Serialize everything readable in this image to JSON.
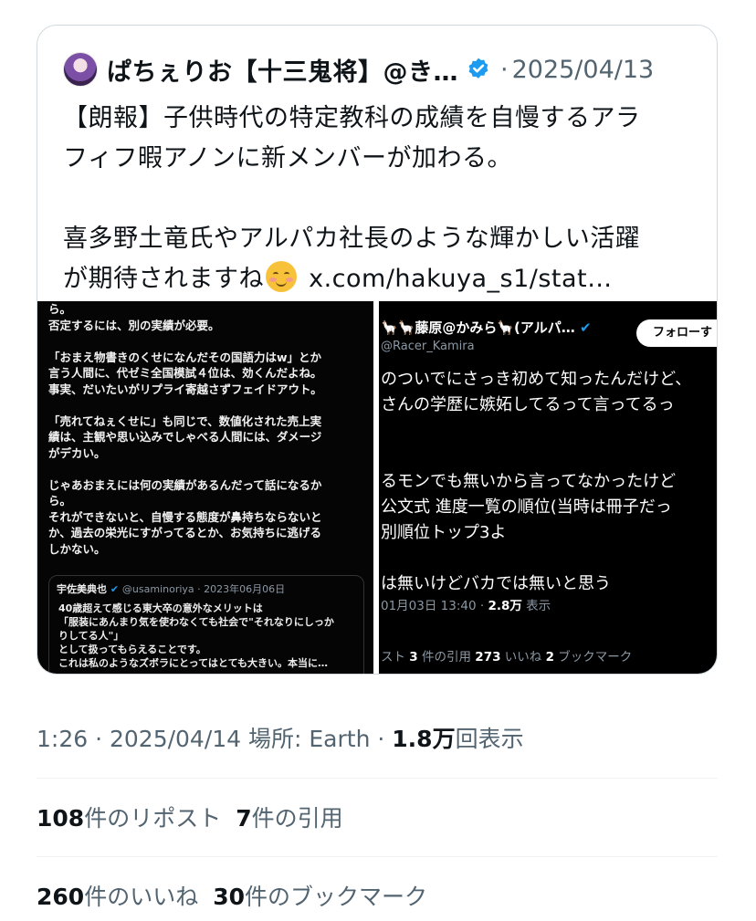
{
  "quoted": {
    "author_name": "ぱちぇりお【十三鬼将】@き…",
    "separator": "·",
    "date": "2025/04/13",
    "text_line1": "【朗報】子供時代の特定教科の成績を自慢するアラ\nフィフ暇アノンに新メンバーが加わる。\n\n喜多野土竜氏やアルパカ社長のような輝かしい活躍\nが期待されますね",
    "link": "x.com/hakuya_s1/stat…",
    "image_left": {
      "body": "ら。\n否定するには、別の実績が必要。\n\n「おまえ物書きのくせになんだその国語力はw」とか\n言う人間に、代ゼミ全国模試４位は、効くんだよね。\n事実、だいたいがリプライ寄越さずフェイドアウト。\n\n「売れてねぇくせに」も同じで、数値化された売上実\n績は、主観や思い込みでしゃべる人間には、ダメージ\nがデカい。\n\nじゃあおまえには何の実績があるんだって話になるか\nら。\nそれができないと、自慢する態度が鼻持ちならないと\nか、過去の栄光にすがってるとか、お気持ちに逃げる\nしかない。",
      "inner_author": "宇佐美典也",
      "inner_handle": "@usaminoriya · 2023年06月06日",
      "inner_body": "40歳超えて感じる東大卒の意外なメリットは\n「服装にあんまり気を使わなくても社会で\"それなりにしっか\nりしてる人\"」\nとして扱ってもらえることです。\nこれは私のようなズボラにとってはとても大きい。本当に…"
    },
    "image_right": {
      "name": "🦙🦙藤原@かみら🦙(アルパ…",
      "handle": "@Racer_Kamira",
      "follow_label": "フォローす",
      "body": "のついでにさっき初めて知ったんだけど、\nさんの学歴に嫉妬してるって言ってるっ\n\n\nるモンでも無いから言ってなかったけど\n公文式 進度一覧の順位(当時は冊子だっ\n別順位トップ3よ\n\nは無いけどバカでは無いと思う",
      "timestamp": "01月03日 13:40 · ",
      "views_count": "2.8万",
      "views_label": " 表示",
      "stats_prefix": "スト  ",
      "quotes_count": "3",
      "quotes_label": " 件の引用  ",
      "likes_count": "273",
      "likes_label": " いいね  ",
      "bookmarks_count": "2",
      "bookmarks_label": " ブックマーク"
    }
  },
  "meta": {
    "time_date": "1:26 · 2025/04/14 場所: Earth · ",
    "views_count": "1.8万",
    "views_label": "回表示"
  },
  "stats": {
    "reposts_count": "108",
    "reposts_label": "件のリポスト",
    "quotes_count": "7",
    "quotes_label": "件の引用",
    "likes_count": "260",
    "likes_label": "件のいいね",
    "bookmarks_count": "30",
    "bookmarks_label": "件のブックマーク"
  },
  "colors": {
    "verified": "#1d9bf0",
    "muted": "#536471",
    "text": "#0f1419"
  }
}
